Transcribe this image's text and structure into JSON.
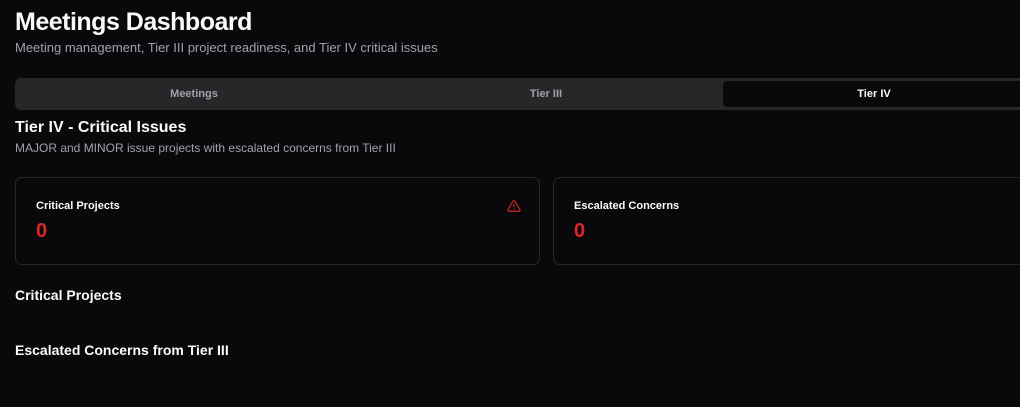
{
  "header": {
    "title": "Meetings Dashboard",
    "subtitle": "Meeting management, Tier III project readiness, and Tier IV critical issues"
  },
  "tabs": [
    {
      "label": "Meetings",
      "active": false
    },
    {
      "label": "Tier III",
      "active": false
    },
    {
      "label": "Tier IV",
      "active": true
    }
  ],
  "section": {
    "title": "Tier IV - Critical Issues",
    "subtitle": "MAJOR and MINOR issue projects with escalated concerns from Tier III"
  },
  "cards": [
    {
      "label": "Critical Projects",
      "value": "0",
      "icon": "alert-triangle-icon"
    },
    {
      "label": "Escalated Concerns",
      "value": "0"
    }
  ],
  "lists": {
    "critical_projects_heading": "Critical Projects",
    "escalated_heading": "Escalated Concerns from Tier III"
  },
  "colors": {
    "background": "#09090b",
    "critical": "#dc2626",
    "muted": "#a1a1aa",
    "border": "#27272a"
  }
}
